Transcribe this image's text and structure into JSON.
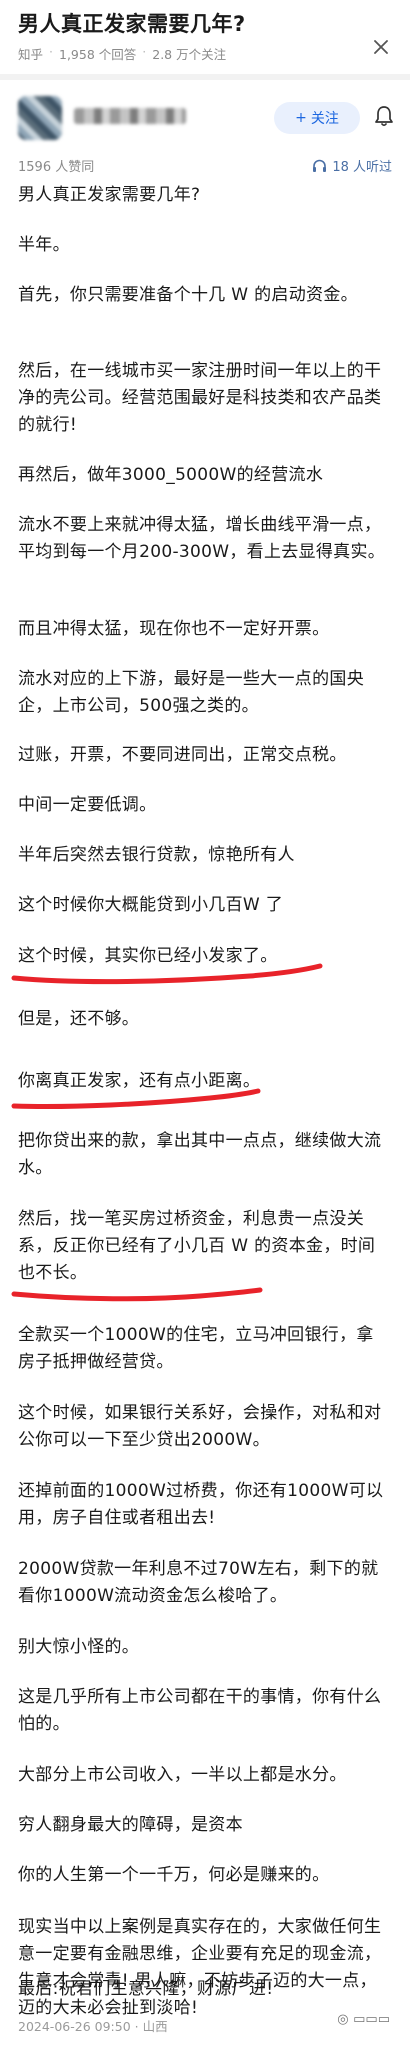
{
  "question": {
    "title": "男人真正发家需要几年?",
    "source": "知乎",
    "answers": "1,958 个回答",
    "followers": "2.8 万个关注"
  },
  "author": {
    "follow_label": "关注",
    "follow_plus": "+"
  },
  "answer": {
    "endorsements": "1596 人赞同",
    "listeners": "18 人听过",
    "paragraphs": [
      "男人真正发家需要几年?",
      "半年。",
      "首先，你只需要准备个十几 W 的启动资金。",
      "然后，在一线城市买一家注册时间一年以上的干净的壳公司。经营范围最好是科技类和农产品类的就行!",
      "再然后，做年3000_5000W的经营流水",
      "流水不要上来就冲得太猛，增长曲线平滑一点，平均到每一个月200-300W，看上去显得真实。",
      "而且冲得太猛，现在你也不一定好开票。",
      "流水对应的上下游，最好是一些大一点的国央企，上市公司，500强之类的。",
      "过账，开票，不要同进同出，正常交点税。",
      "中间一定要低调。",
      "半年后突然去银行贷款，惊艳所有人",
      "这个时候你大概能贷到小几百W 了",
      "这个时候，其实你已经小发家了。",
      "但是，还不够。",
      "你离真正发家，还有点小距离。",
      "把你贷出来的款，拿出其中一点点，继续做大流水。",
      "然后，找一笔买房过桥资金，利息贵一点没关系，反正你已经有了小几百 W 的资本金，时间也不长。",
      "全款买一个1000W的住宅，立马冲回银行，拿房子抵押做经营贷。",
      "这个时候，如果银行关系好，会操作，对私和对公你可以一下至少贷出2000W。",
      "还掉前面的1000W过桥费，你还有1000W可以用，房子自住或者租出去!",
      "2000W贷款一年利息不过70W左右，剩下的就看你1000W流动资金怎么梭哈了。",
      "别大惊小怪的。",
      "这是几乎所有上市公司都在干的事情，你有什么怕的。",
      "大部分上市公司收入，一半以上都是水分。",
      "穷人翻身最大的障碍，是资本",
      "你的人生第一个一千万，何必是赚来的。",
      "现实当中以上案例是真实存在的，大家做任何生意一定要有金融思维，企业要有充足的现金流，生意才会常青! 男人嘛，不妨步子迈的大一点，迈的大未必会扯到淡哈!",
      "最后:祝君们生意兴隆，财源广进!"
    ]
  },
  "footer": {
    "date": "2024-06-26 09:50",
    "location": "山西"
  },
  "colors": {
    "accent_blue": "#1b66e0",
    "follow_bg": "#e9f0fd",
    "highlight_red": "#e8232a",
    "meta_gray": "#8a8a8a"
  },
  "icons": [
    "close-icon",
    "bell-icon",
    "headphones-icon"
  ]
}
